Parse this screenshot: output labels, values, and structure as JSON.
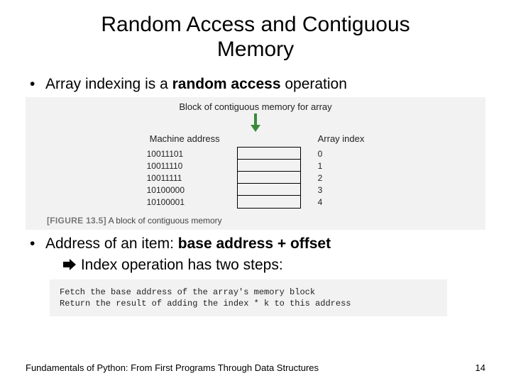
{
  "title_line1": "Random Access and Contiguous",
  "title_line2": "Memory",
  "bullet1_pre": "Array indexing is a ",
  "bullet1_bold": "random access",
  "bullet1_post": " operation",
  "figure": {
    "top_label": "Block of contiguous memory for array",
    "addr_header": "Machine address",
    "idx_header": "Array index",
    "addresses": [
      "10011101",
      "10011110",
      "10011111",
      "10100000",
      "10100001"
    ],
    "indices": [
      "0",
      "1",
      "2",
      "3",
      "4"
    ],
    "caption_tag": "[FIGURE 13.5]",
    "caption_text": " A block of contiguous memory"
  },
  "bullet2_pre": "Address of an item: ",
  "bullet2_bold": "base address + offset",
  "sub_text": " Index operation has two steps:",
  "code": {
    "line1": "Fetch the base address of the array's memory block",
    "line2": "Return the result of adding the index * k to this address"
  },
  "footer_left": "Fundamentals of Python: From First Programs Through Data Structures",
  "footer_right": "14"
}
